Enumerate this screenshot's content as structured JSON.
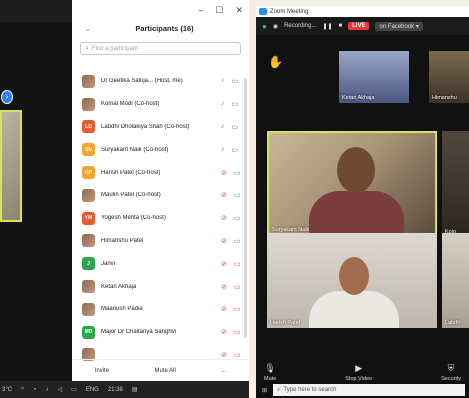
{
  "left": {
    "window_controls": [
      "–",
      "☐",
      "✕"
    ],
    "panel_title": "Participants (16)",
    "search_placeholder": "Find a participant",
    "participants": [
      {
        "name": "Dr Geetika Saluja... (Host, me)",
        "initials": "",
        "color": "#8b6a55",
        "photo": true,
        "mic": "on",
        "video": "on"
      },
      {
        "name": "Komal Modi (Co-host)",
        "initials": "",
        "color": "#8b6a55",
        "photo": true,
        "mic": "on",
        "video": "on"
      },
      {
        "name": "Labdhi Dholakiya Shah (Co-host)",
        "initials": "LD",
        "color": "#e85c2b",
        "photo": false,
        "mic": "on",
        "video": "on"
      },
      {
        "name": "Suryakant Naik (Co-host)",
        "initials": "SN",
        "color": "#f2a531",
        "photo": false,
        "mic": "on",
        "video": "on"
      },
      {
        "name": "Harish Patel (Co-host)",
        "initials": "HP",
        "color": "#f2a531",
        "photo": false,
        "mic": "off",
        "video": "on"
      },
      {
        "name": "Maulin Patel (Co-host)",
        "initials": "",
        "color": "#8b6a55",
        "photo": true,
        "mic": "off",
        "video": "on"
      },
      {
        "name": "Yogesh Mehta (Co-host)",
        "initials": "YM",
        "color": "#e85c2b",
        "photo": false,
        "mic": "off",
        "video": "on"
      },
      {
        "name": "Himanshu Patel",
        "initials": "",
        "color": "#8b6a55",
        "photo": true,
        "mic": "off",
        "video": "on"
      },
      {
        "name": "Janvi",
        "initials": "J",
        "color": "#2aa74a",
        "photo": false,
        "mic": "off",
        "video": "off"
      },
      {
        "name": "Ketan Akhaja",
        "initials": "",
        "color": "#8b6a55",
        "photo": true,
        "mic": "off",
        "video": "off"
      },
      {
        "name": "Maanush Padia",
        "initials": "",
        "color": "#8b6a55",
        "photo": true,
        "mic": "off",
        "video": "off"
      },
      {
        "name": "Major Dr Chaitanya Sanghvi",
        "initials": "MD",
        "color": "#2aa74a",
        "photo": false,
        "mic": "off",
        "video": "off"
      },
      {
        "name": "",
        "initials": "",
        "color": "#8b6a55",
        "photo": true,
        "mic": "off",
        "video": "off"
      }
    ],
    "footer": {
      "invite": "Invite",
      "mute_all": "Mute All",
      "more": "..."
    },
    "taskbar": {
      "temp": "3°C",
      "lang": "ENG",
      "time": "21:38"
    }
  },
  "right": {
    "title": "Zoom Meeting",
    "recording": "Recording...",
    "live": "LIVE",
    "live_target": "on Facebook ▾",
    "tiles": {
      "t1": "Ketan Akhaja",
      "t2": "Himanshu",
      "t3": "Suryakant Naik",
      "t4": "Harish Patel",
      "t5": "Kojo",
      "t6": "Labdh"
    },
    "controls": {
      "mute": "Mute",
      "stop_video": "Stop Video",
      "security": "Security"
    },
    "search": "Type here to search"
  }
}
